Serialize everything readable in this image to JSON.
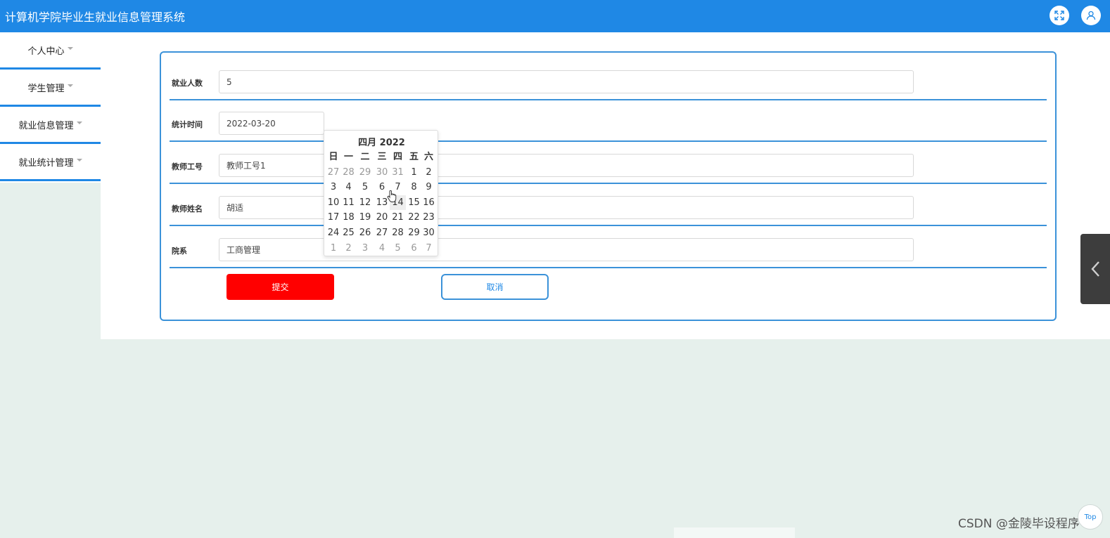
{
  "header": {
    "title": "计算机学院毕业生就业信息管理系统",
    "fullscreen_icon": "expand-icon",
    "user_icon": "user-icon",
    "accent_color": "#1f88e5"
  },
  "sidebar": {
    "items": [
      {
        "label": "个人中心"
      },
      {
        "label": "学生管理"
      },
      {
        "label": "就业信息管理"
      },
      {
        "label": "就业统计管理"
      }
    ]
  },
  "form": {
    "fields": [
      {
        "label": "就业人数",
        "value": "5"
      },
      {
        "label": "统计时间",
        "value": "2022-03-20"
      },
      {
        "label": "教师工号",
        "value": "教师工号1"
      },
      {
        "label": "教师姓名",
        "value": "胡适"
      },
      {
        "label": "院系",
        "value": "工商管理"
      }
    ],
    "submit_label": "提交",
    "cancel_label": "取消",
    "submit_color": "#ff0000"
  },
  "datepicker": {
    "title": "四月 2022",
    "weekdays": [
      "日",
      "一",
      "二",
      "三",
      "四",
      "五",
      "六"
    ],
    "weeks": [
      [
        "27",
        "28",
        "29",
        "30",
        "31",
        "1",
        "2"
      ],
      [
        "3",
        "4",
        "5",
        "6",
        "7",
        "8",
        "9"
      ],
      [
        "10",
        "11",
        "12",
        "13",
        "14",
        "15",
        "16"
      ],
      [
        "17",
        "18",
        "19",
        "20",
        "21",
        "22",
        "23"
      ],
      [
        "24",
        "25",
        "26",
        "27",
        "28",
        "29",
        "30"
      ],
      [
        "1",
        "2",
        "3",
        "4",
        "5",
        "6",
        "7"
      ]
    ],
    "hovered_day": "14"
  },
  "watermark": "CSDN @金陵毕设程序",
  "back_to_top_label": "Top"
}
